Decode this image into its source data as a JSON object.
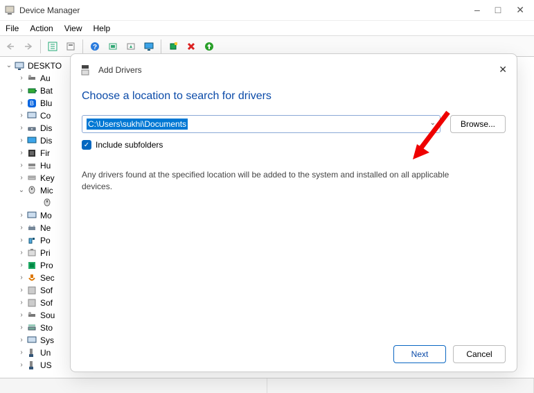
{
  "titlebar": {
    "title": "Device Manager"
  },
  "menubar": {
    "file": "File",
    "action": "Action",
    "view": "View",
    "help": "Help"
  },
  "tree": {
    "root": "DESKTO",
    "items": [
      {
        "label": "Au",
        "expander": ">"
      },
      {
        "label": "Bat",
        "expander": ">"
      },
      {
        "label": "Blu",
        "expander": ">"
      },
      {
        "label": "Co",
        "expander": ">"
      },
      {
        "label": "Dis",
        "expander": ">"
      },
      {
        "label": "Dis",
        "expander": ">"
      },
      {
        "label": "Fir",
        "expander": ">"
      },
      {
        "label": "Hu",
        "expander": ">"
      },
      {
        "label": "Key",
        "expander": ">"
      },
      {
        "label": "Mic",
        "expander": "v"
      },
      {
        "label": "",
        "expander": "",
        "child": true
      },
      {
        "label": "Mo",
        "expander": ">"
      },
      {
        "label": "Ne",
        "expander": ">"
      },
      {
        "label": "Po",
        "expander": ">"
      },
      {
        "label": "Pri",
        "expander": ">"
      },
      {
        "label": "Pro",
        "expander": ">"
      },
      {
        "label": "Sec",
        "expander": ">"
      },
      {
        "label": "Sof",
        "expander": ">"
      },
      {
        "label": "Sof",
        "expander": ">"
      },
      {
        "label": "Sou",
        "expander": ">"
      },
      {
        "label": "Sto",
        "expander": ">"
      },
      {
        "label": "Sys",
        "expander": ">"
      },
      {
        "label": "Un",
        "expander": ">"
      },
      {
        "label": "US",
        "expander": ">"
      }
    ]
  },
  "dialog": {
    "title": "Add Drivers",
    "heading": "Choose a location to search for drivers",
    "path": "C:\\Users\\sukhi\\Documents",
    "browse": "Browse...",
    "include_subfolders": "Include subfolders",
    "description": "Any drivers found at the specified location will be added to the system and installed on all applicable devices.",
    "next": "Next",
    "cancel": "Cancel"
  }
}
